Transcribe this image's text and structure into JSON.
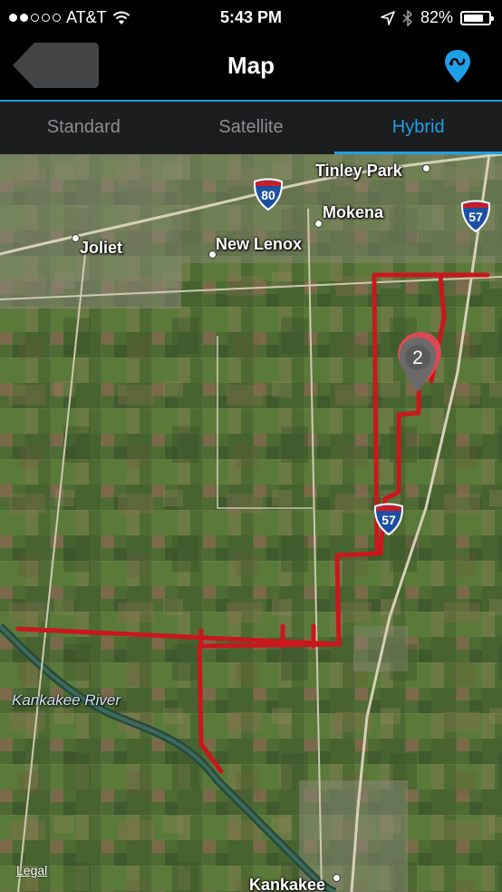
{
  "status_bar": {
    "carrier": "AT&T",
    "time": "5:43 PM",
    "battery": "82%",
    "battery_level": 0.82,
    "signal_bars_filled": 2,
    "signal_bars_total": 5
  },
  "nav": {
    "title": "Map",
    "back_icon": "back-arrow-icon",
    "route_icon": "route-pin-icon",
    "accent_color": "#1ea0e6"
  },
  "tabs": [
    {
      "label": "Standard",
      "active": false
    },
    {
      "label": "Satellite",
      "active": false
    },
    {
      "label": "Hybrid",
      "active": true
    }
  ],
  "map": {
    "places": {
      "tinley_park": "Tinley Park",
      "mokena": "Mokena",
      "joliet": "Joliet",
      "new_lenox": "New Lenox",
      "kankakee": "Kankakee"
    },
    "river": "Kankakee River",
    "highways": {
      "i80": "80",
      "i57_north": "57",
      "i57_mid": "57"
    },
    "marker_count": "2",
    "route_color": "#c8171d",
    "legal": "Legal"
  }
}
